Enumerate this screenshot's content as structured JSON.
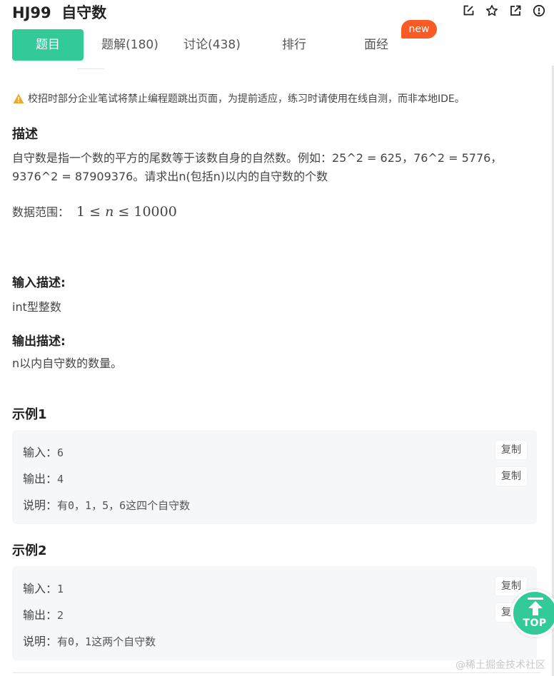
{
  "header": {
    "title": "HJ99  自守数",
    "icons": [
      "edit-icon",
      "star-icon",
      "external-link-icon",
      "info-icon"
    ]
  },
  "tabs": [
    {
      "label": "题目",
      "active": true
    },
    {
      "label": "题解(180)",
      "active": false
    },
    {
      "label": "讨论(438)",
      "active": false
    },
    {
      "label": "排行",
      "active": false
    },
    {
      "label": "面经",
      "active": false
    }
  ],
  "badge_new": "new",
  "notice": "校招时部分企业笔试将禁止编程题跳出页面，为提前适应，练习时请使用在线自测，而非本地IDE。",
  "description": {
    "title": "描述",
    "line1": "自守数是指一个数的平方的尾数等于该数自身的自然数。例如：25^2 = 625，76^2 = 5776，",
    "line2": "9376^2 = 87909376。请求出n(包括n)以内的自守数的个数",
    "range_label": "数据范围：",
    "range_min": "1",
    "range_var": "n",
    "range_max": "10000"
  },
  "input_desc": {
    "title": "输入描述:",
    "text": "int型整数"
  },
  "output_desc": {
    "title": "输出描述:",
    "text": "n以内自守数的数量。"
  },
  "examples": [
    {
      "title": "示例1",
      "input_label": "输入：",
      "input": "6",
      "output_label": "输出：",
      "output": "4",
      "note_label": "说明：",
      "note": "有0，1，5，6这四个自守数",
      "copy_label": "复制"
    },
    {
      "title": "示例2",
      "input_label": "输入：",
      "input": "1",
      "output_label": "输出：",
      "output": "2",
      "note_label": "说明：",
      "note": "有0，1这两个自守数",
      "copy_label": "复制"
    }
  ],
  "top_button": "TOP",
  "watermark": "@稀土掘金技术社区",
  "colors": {
    "accent": "#32ca99",
    "badge": "#fb5a24",
    "warning": "#f5a623"
  }
}
